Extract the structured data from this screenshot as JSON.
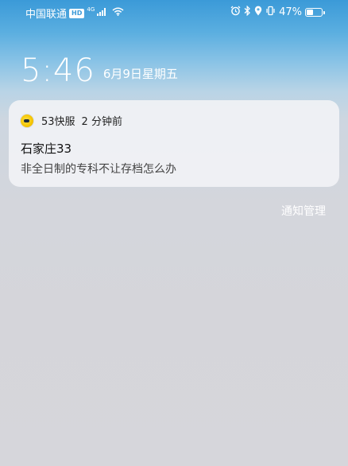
{
  "status_bar": {
    "carrier": "中国联通",
    "hd_badge": "HD",
    "network_type": "4G",
    "battery_percent": "47%",
    "battery_level": 0.47,
    "left_icons": [
      "hd-icon",
      "signal-icon",
      "wifi-icon"
    ],
    "right_icons": [
      "alarm-icon",
      "bluetooth-icon",
      "location-icon",
      "vibrate-icon",
      "battery-icon"
    ]
  },
  "lockscreen": {
    "time": "5:46",
    "date": "6月9日星期五"
  },
  "notification": {
    "app_name": "53快服",
    "time_ago": "2 分钟前",
    "title": "石家庄33",
    "body": "非全日制的专科不让存档怎么办",
    "app_icon": "app-icon-53kf"
  },
  "notification_manage": {
    "label": "通知管理"
  },
  "colors": {
    "top_gradient": "#3b9ad8",
    "background": "#d6d6db",
    "card": "#f1f2f5",
    "text_white": "#ffffff"
  }
}
